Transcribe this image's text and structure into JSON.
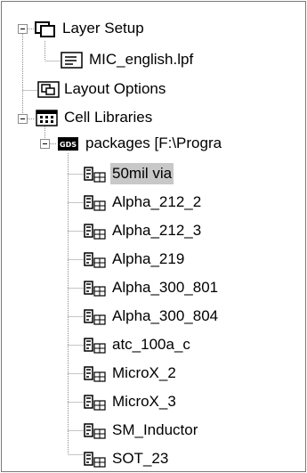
{
  "tree": {
    "layer_setup": {
      "label": "Layer Setup",
      "icon": "layer-setup-icon",
      "expanded": true,
      "children": [
        {
          "label": "MIC_english.lpf",
          "icon": "file-icon"
        }
      ]
    },
    "layout_options": {
      "label": "Layout Options",
      "icon": "layout-options-icon"
    },
    "cell_libraries": {
      "label": "Cell Libraries",
      "icon": "cell-libraries-icon",
      "expanded": true,
      "packages": {
        "label": "packages [F:\\Progra",
        "icon": "gds-icon",
        "icon_text": "GDS",
        "expanded": true,
        "cells": [
          {
            "label": "50mil via",
            "selected": true
          },
          {
            "label": "Alpha_212_2"
          },
          {
            "label": "Alpha_212_3"
          },
          {
            "label": "Alpha_219"
          },
          {
            "label": "Alpha_300_801"
          },
          {
            "label": "Alpha_300_804"
          },
          {
            "label": "atc_100a_c"
          },
          {
            "label": "MicroX_2"
          },
          {
            "label": "MicroX_3"
          },
          {
            "label": "SM_Inductor"
          },
          {
            "label": "SOT_23"
          }
        ]
      }
    }
  }
}
